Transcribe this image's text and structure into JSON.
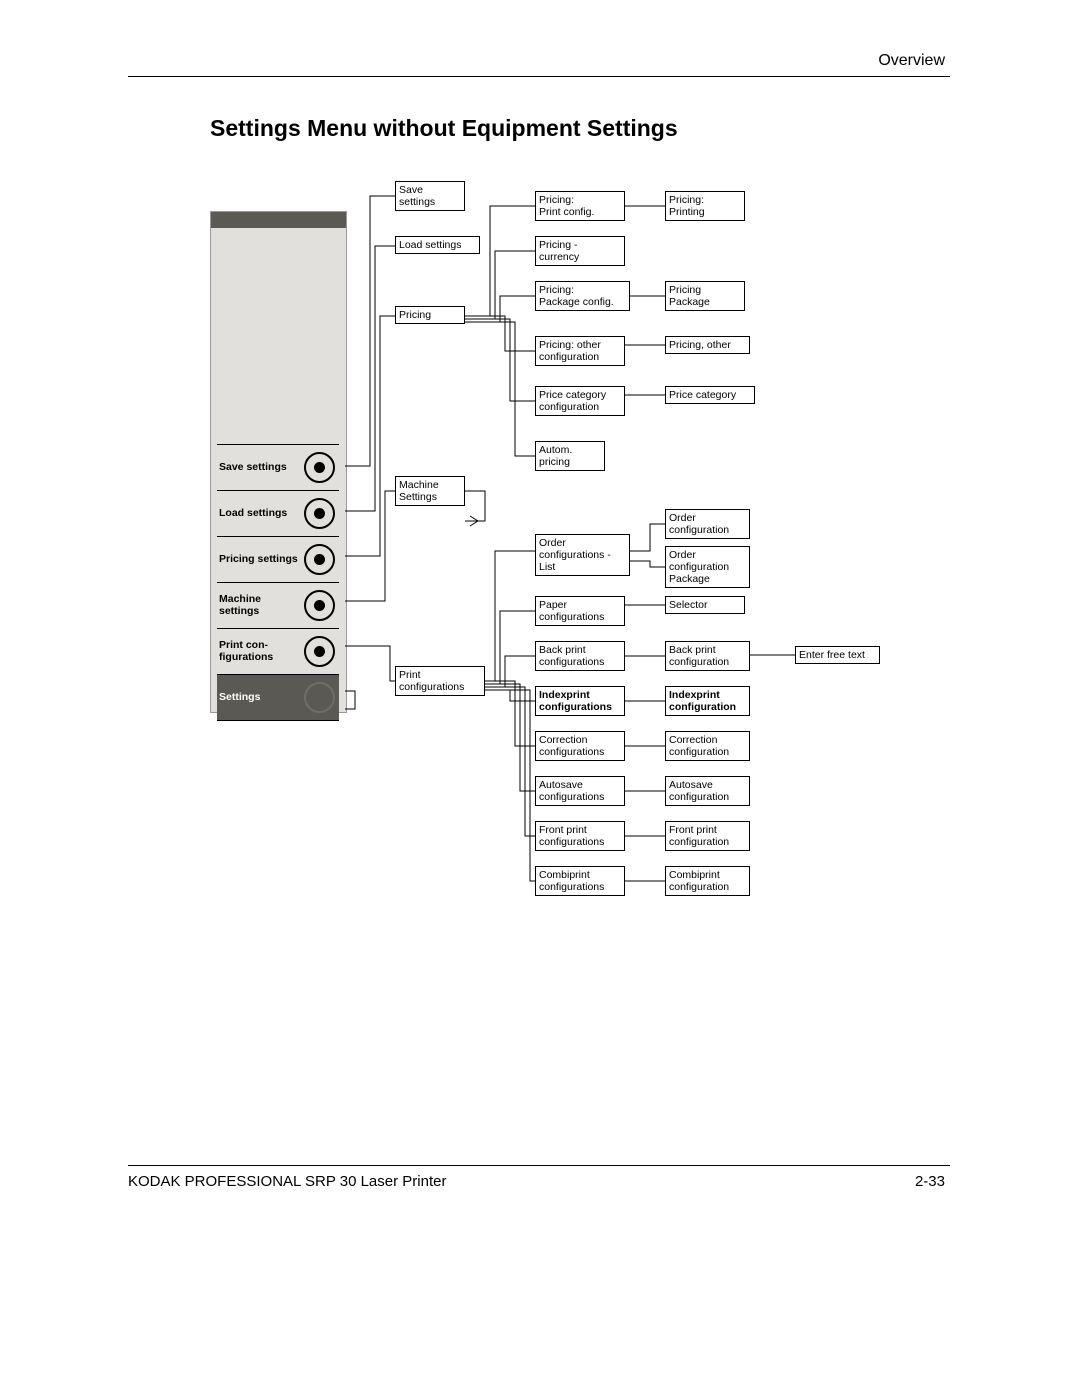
{
  "header": {
    "topRight": "Overview"
  },
  "title": "Settings Menu without Equipment Settings",
  "menu": {
    "items": [
      {
        "label": "Save settings"
      },
      {
        "label": "Load settings"
      },
      {
        "label": "Pricing settings"
      },
      {
        "label": "Machine settings"
      },
      {
        "label": "Print con-figurations"
      },
      {
        "label": "Settings"
      }
    ]
  },
  "col2": {
    "saveSettings": "Save settings",
    "loadSettings": "Load settings",
    "pricing": "Pricing",
    "machineSettings": "Machine Settings",
    "printConfigurations": "Print configurations"
  },
  "col3": {
    "pricingPrintConfig": "Pricing:\nPrint config.",
    "pricingCurrency": "Pricing -\ncurrency",
    "pricingPackageConfig": "Pricing:\nPackage config.",
    "pricingOtherConfig": "Pricing: other\nconfiguration",
    "priceCategoryConfig": "Price category configuration",
    "automPricing": "Autom.\npricing",
    "orderConfigsList": "Order configurations - List",
    "paperConfigs": "Paper\nconfigurations",
    "backPrintConfigs": "Back print\nconfigurations",
    "indexprintConfigs": "Indexprint configurations",
    "correctionConfigs": "Correction configurations",
    "autosaveConfigs": "Autosave configurations",
    "frontPrintConfigs": "Front print configurations",
    "combiprintConfigs": "Combiprint configurations"
  },
  "col4": {
    "pricingPrinting": "Pricing:\nPrinting",
    "pricingPackage": "Pricing\nPackage",
    "pricingOther": "Pricing, other",
    "priceCategory": "Price category",
    "orderConfig": "Order\nconfiguration",
    "orderConfigPackage": "Order configuration Package",
    "selector": "Selector",
    "backPrintConfig": "Back print\nconfiguration",
    "indexprintConfig": "Indexprint configuration",
    "correctionConfig": "Correction configuration",
    "autosaveConfig": "Autosave\nconfiguration",
    "frontPrintConfig": "Front print\nconfiguration",
    "combiprintConfig": "Combiprint\nconfiguration"
  },
  "col5": {
    "enterFreeText": "Enter free text"
  },
  "footer": {
    "left": "KODAK PROFESSIONAL SRP 30 Laser Printer",
    "right": "2-33"
  }
}
